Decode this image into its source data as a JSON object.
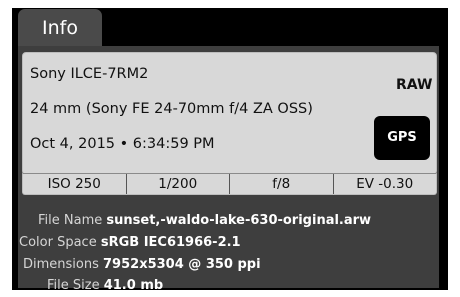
{
  "tab": {
    "label": "Info"
  },
  "camera": {
    "model": "Sony ILCE-7RM2",
    "lens": "24 mm (Sony FE 24-70mm f/4 ZA OSS)",
    "datetime": "Oct 4, 2015 • 6:34:59 PM",
    "raw_badge": "RAW",
    "gps_button": "GPS"
  },
  "exposure": {
    "iso": "ISO 250",
    "shutter": "1/200",
    "aperture": "f/8",
    "ev": "EV -0.30"
  },
  "metadata": [
    {
      "label": "File Name",
      "value": "sunset,-waldo-lake-630-original.arw"
    },
    {
      "label": "Color Space",
      "value": "sRGB IEC61966-2.1"
    },
    {
      "label": "Dimensions",
      "value": "7952x5304 @ 350 ppi"
    },
    {
      "label": "File Size",
      "value": "41.0 mb"
    }
  ]
}
